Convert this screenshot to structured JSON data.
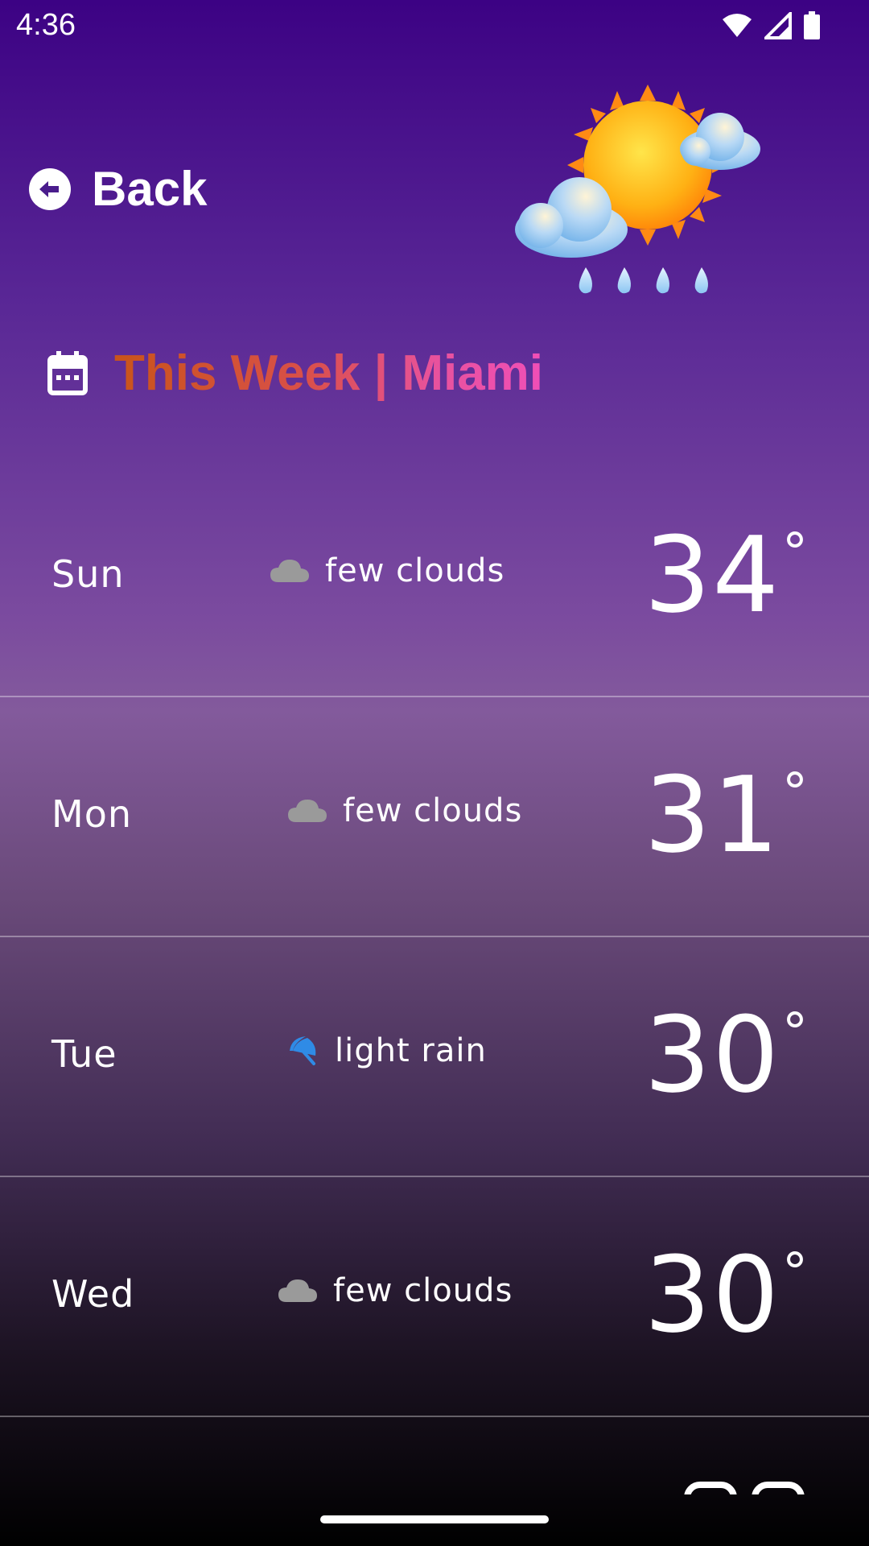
{
  "status_bar": {
    "time": "4:36",
    "icons": [
      "wifi-icon",
      "cell-signal-icon",
      "battery-icon"
    ]
  },
  "nav": {
    "back_label": "Back"
  },
  "header": {
    "title": "This Week | Miami",
    "icon": "calendar-icon"
  },
  "forecast": [
    {
      "day": "Sun",
      "condition": "few clouds",
      "icon": "cloud-icon",
      "temp": "34",
      "unit": "°"
    },
    {
      "day": "Mon",
      "condition": "few clouds",
      "icon": "cloud-icon",
      "temp": "31",
      "unit": "°"
    },
    {
      "day": "Tue",
      "condition": "light rain",
      "icon": "umbrella-icon",
      "temp": "30",
      "unit": "°"
    },
    {
      "day": "Wed",
      "condition": "few clouds",
      "icon": "cloud-icon",
      "temp": "30",
      "unit": "°"
    }
  ],
  "colors": {
    "background_top": "#3c0284",
    "background_bottom": "#000000",
    "title_gradient_start": "#c9541a",
    "title_gradient_end": "#f04fb7",
    "cloud_icon": "#9a9a9a",
    "umbrella_icon": "#2f8be6"
  }
}
